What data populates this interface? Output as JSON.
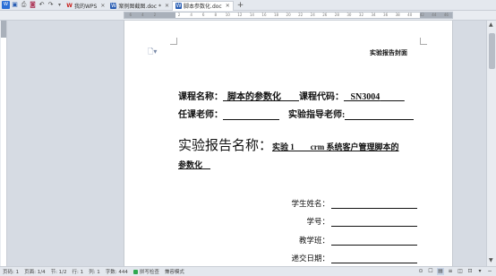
{
  "tabs": [
    {
      "label": "我的WPS",
      "active": false
    },
    {
      "label": "案例图截图.doc *",
      "active": false
    },
    {
      "label": "脚本参数化.doc",
      "active": true
    }
  ],
  "tab_add": "+",
  "ruler_ticks": [
    "6",
    "4",
    "2",
    "",
    "2",
    "4",
    "6",
    "8",
    "10",
    "12",
    "14",
    "16",
    "18",
    "20",
    "22",
    "24",
    "26",
    "28",
    "30",
    "32",
    "34",
    "36",
    "38",
    "40",
    "42",
    "44",
    "46"
  ],
  "document": {
    "header": "实验报告封面",
    "course_name_label": "课程名称：",
    "course_name": "脚本的参数化",
    "course_code_label": "课程代码：",
    "course_code": "SN3004",
    "teacher_label": "任课老师：",
    "instructor_label": "实验指导老师:",
    "report_title_label": "实验报告名称：",
    "report_title_value": "实验 1　　crm 系统客户管理脚本的",
    "report_title_cont": "参数化",
    "student_name_label": "学生姓名：",
    "student_id_label": "学号：",
    "class_label": "教学班：",
    "submit_date_label": "递交日期："
  },
  "status": {
    "page": "页码: 1",
    "pages": "页面: 1/4",
    "section": "节: 1/2",
    "row": "行: 1",
    "col": "列: 1",
    "words": "字数: 444",
    "spell": "拼写检查",
    "compat": "兼容模式"
  },
  "icons": {
    "app": "wps-menu-icon",
    "save": "save-icon",
    "print": "print-icon",
    "preview": "print-preview-icon",
    "undo": "undo-icon",
    "redo": "redo-icon"
  }
}
